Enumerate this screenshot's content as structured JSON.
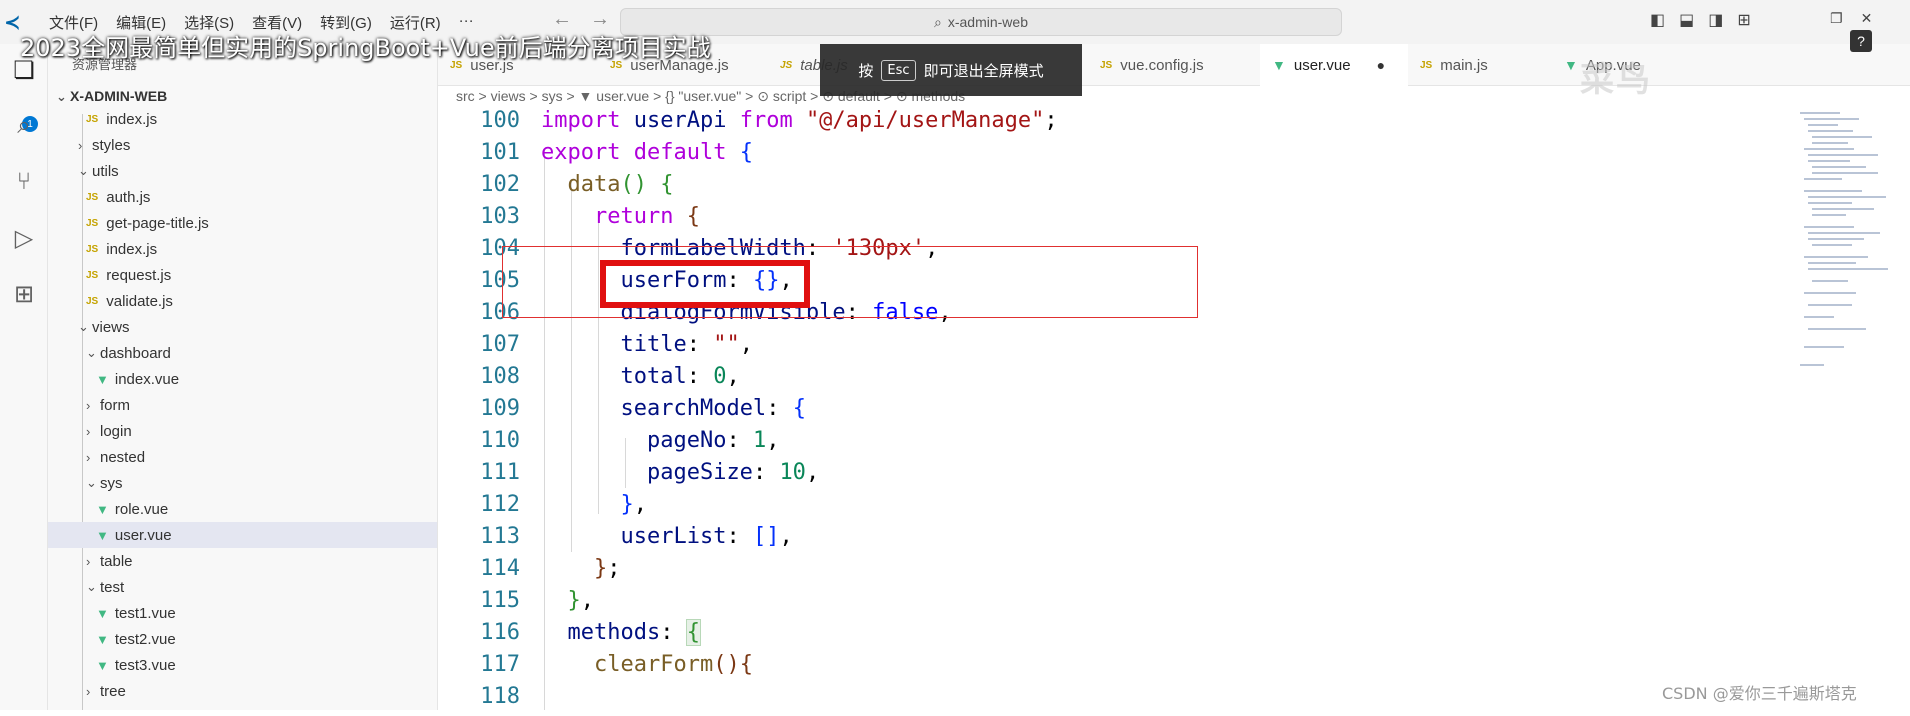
{
  "window": {
    "menus": [
      "文件(F)",
      "编辑(E)",
      "选择(S)",
      "查看(V)",
      "转到(G)",
      "运行(R)",
      "···"
    ],
    "search_text": "x-admin-web",
    "video_title": "2023全网最简单但实用的SpringBoot+Vue前后端分离项目实战"
  },
  "activity": {
    "badge": "1"
  },
  "sidebar": {
    "header": "资源管理器",
    "root": "X-ADMIN-WEB",
    "items": [
      {
        "label": "index.js",
        "kind": "js"
      },
      {
        "label": "styles",
        "kind": "folder",
        "open": false
      },
      {
        "label": "utils",
        "kind": "folder",
        "open": true
      },
      {
        "label": "auth.js",
        "kind": "js"
      },
      {
        "label": "get-page-title.js",
        "kind": "js"
      },
      {
        "label": "index.js",
        "kind": "js"
      },
      {
        "label": "request.js",
        "kind": "js"
      },
      {
        "label": "validate.js",
        "kind": "js"
      },
      {
        "label": "views",
        "kind": "folder",
        "open": true
      },
      {
        "label": "dashboard",
        "kind": "folder",
        "open": true
      },
      {
        "label": "index.vue",
        "kind": "vue"
      },
      {
        "label": "form",
        "kind": "folder",
        "open": false
      },
      {
        "label": "login",
        "kind": "folder",
        "open": false
      },
      {
        "label": "nested",
        "kind": "folder",
        "open": false
      },
      {
        "label": "sys",
        "kind": "folder",
        "open": true
      },
      {
        "label": "role.vue",
        "kind": "vue"
      },
      {
        "label": "user.vue",
        "kind": "vue",
        "selected": true
      },
      {
        "label": "table",
        "kind": "folder",
        "open": false
      },
      {
        "label": "test",
        "kind": "folder",
        "open": true
      },
      {
        "label": "test1.vue",
        "kind": "vue"
      },
      {
        "label": "test2.vue",
        "kind": "vue"
      },
      {
        "label": "test3.vue",
        "kind": "vue"
      },
      {
        "label": "tree",
        "kind": "folder",
        "open": false
      }
    ]
  },
  "tabs": [
    {
      "label": "user.js",
      "kind": "js"
    },
    {
      "label": "userManage.js",
      "kind": "js"
    },
    {
      "label": "table.js",
      "kind": "js"
    },
    {
      "label": "vue.config.js",
      "kind": "js"
    },
    {
      "label": "user.vue",
      "kind": "vue",
      "active": true,
      "dirty": "●"
    },
    {
      "label": "main.js",
      "kind": "js"
    },
    {
      "label": "App.vue",
      "kind": "vue"
    }
  ],
  "breadcrumb": "src > views > sys > ▼ user.vue > {} \"user.vue\" > ⊙ script > ⊙ default > ⊙ methods",
  "esc_overlay": {
    "press": "按",
    "key": "Esc",
    "text": "即可退出全屏模式"
  },
  "editor": {
    "lines": [
      {
        "n": "100",
        "code": "import userApi from \"@/api/userManage\";"
      },
      {
        "n": "101",
        "code": "export default {"
      },
      {
        "n": "102",
        "code": "  data() {"
      },
      {
        "n": "103",
        "code": "    return {"
      },
      {
        "n": "104",
        "code": "      formLabelWidth: '130px',"
      },
      {
        "n": "105",
        "code": "      userForm: {},"
      },
      {
        "n": "106",
        "code": "      dialogFormVisible: false,"
      },
      {
        "n": "107",
        "code": "      title: \"\","
      },
      {
        "n": "108",
        "code": "      total: 0,"
      },
      {
        "n": "109",
        "code": "      searchModel: {"
      },
      {
        "n": "110",
        "code": "        pageNo: 1,"
      },
      {
        "n": "111",
        "code": "        pageSize: 10,"
      },
      {
        "n": "112",
        "code": "      },"
      },
      {
        "n": "113",
        "code": "      userList: [],"
      },
      {
        "n": "114",
        "code": "    };"
      },
      {
        "n": "115",
        "code": "  },"
      },
      {
        "n": "116",
        "code": "  methods: {"
      },
      {
        "n": "117",
        "code": "    clearForm(){"
      },
      {
        "n": "118",
        "code": ""
      }
    ]
  },
  "watermarks": {
    "top": "菜鸟",
    "bottom": "CSDN @爱你三千遍斯塔克"
  },
  "colors": {
    "highlight": "#e01010",
    "accent": "#0078d4"
  }
}
